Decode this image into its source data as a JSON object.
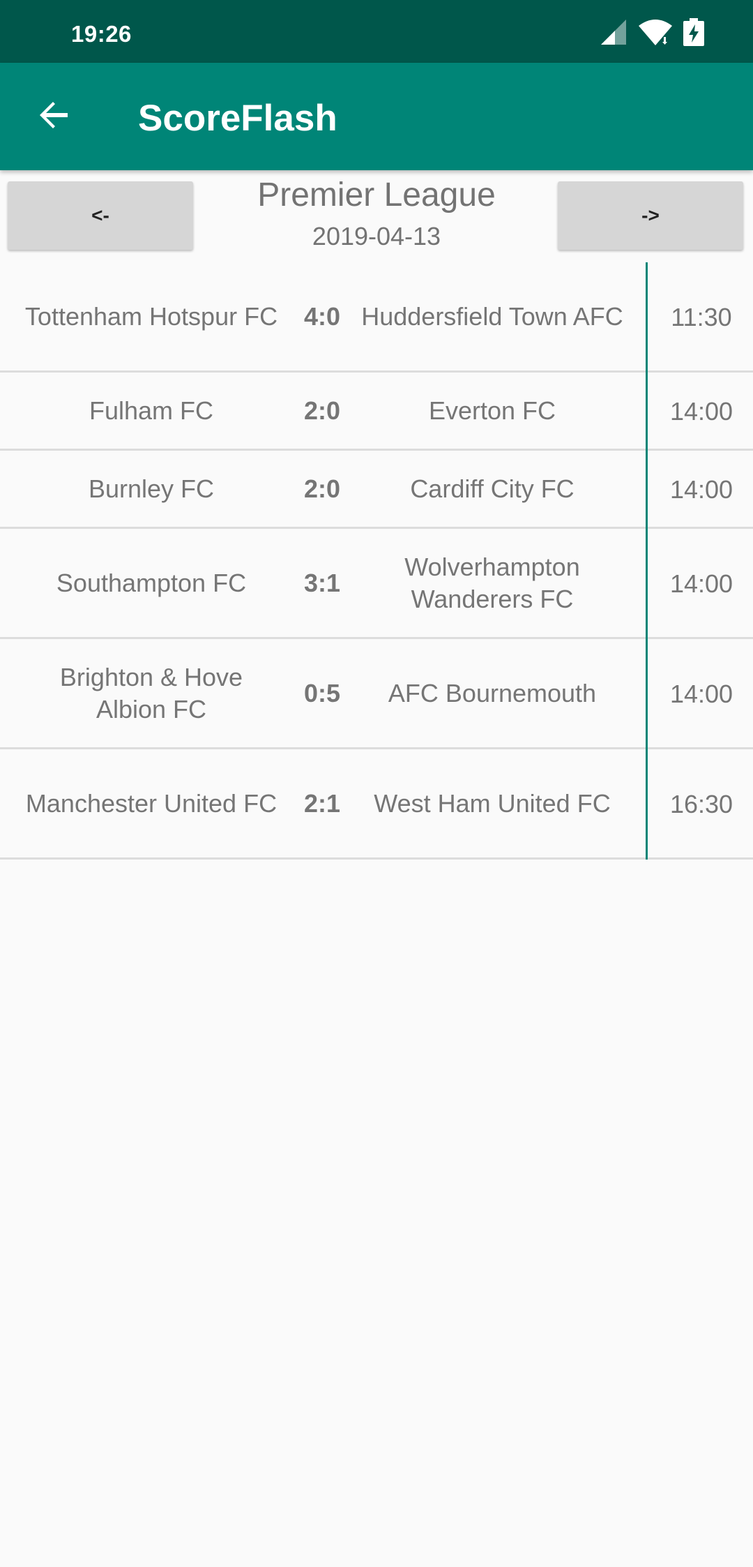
{
  "status_bar": {
    "time": "19:26",
    "icons": [
      "signal-icon",
      "wifi-icon",
      "battery-charging-icon"
    ]
  },
  "app_bar": {
    "title": "ScoreFlash",
    "back_icon": "arrow-back-icon"
  },
  "navigation": {
    "prev_label": "<-",
    "next_label": "->",
    "league": "Premier League",
    "date": "2019-04-13"
  },
  "matches": [
    {
      "home": "Tottenham Hotspur FC",
      "score": "4:0",
      "away": "Huddersfield Town AFC",
      "time": "11:30"
    },
    {
      "home": "Fulham FC",
      "score": "2:0",
      "away": "Everton FC",
      "time": "14:00"
    },
    {
      "home": "Burnley FC",
      "score": "2:0",
      "away": "Cardiff City FC",
      "time": "14:00"
    },
    {
      "home": "Southampton FC",
      "score": "3:1",
      "away": "Wolverhampton Wanderers FC",
      "time": "14:00"
    },
    {
      "home": "Brighton & Hove Albion FC",
      "score": "0:5",
      "away": "AFC Bournemouth",
      "time": "14:00"
    },
    {
      "home": "Manchester United FC",
      "score": "2:1",
      "away": "West Ham United FC",
      "time": "16:30"
    }
  ],
  "colors": {
    "status_bar": "#00574b",
    "app_bar": "#008577",
    "accent": "#008577",
    "text": "#757575",
    "background": "#fafafa"
  }
}
